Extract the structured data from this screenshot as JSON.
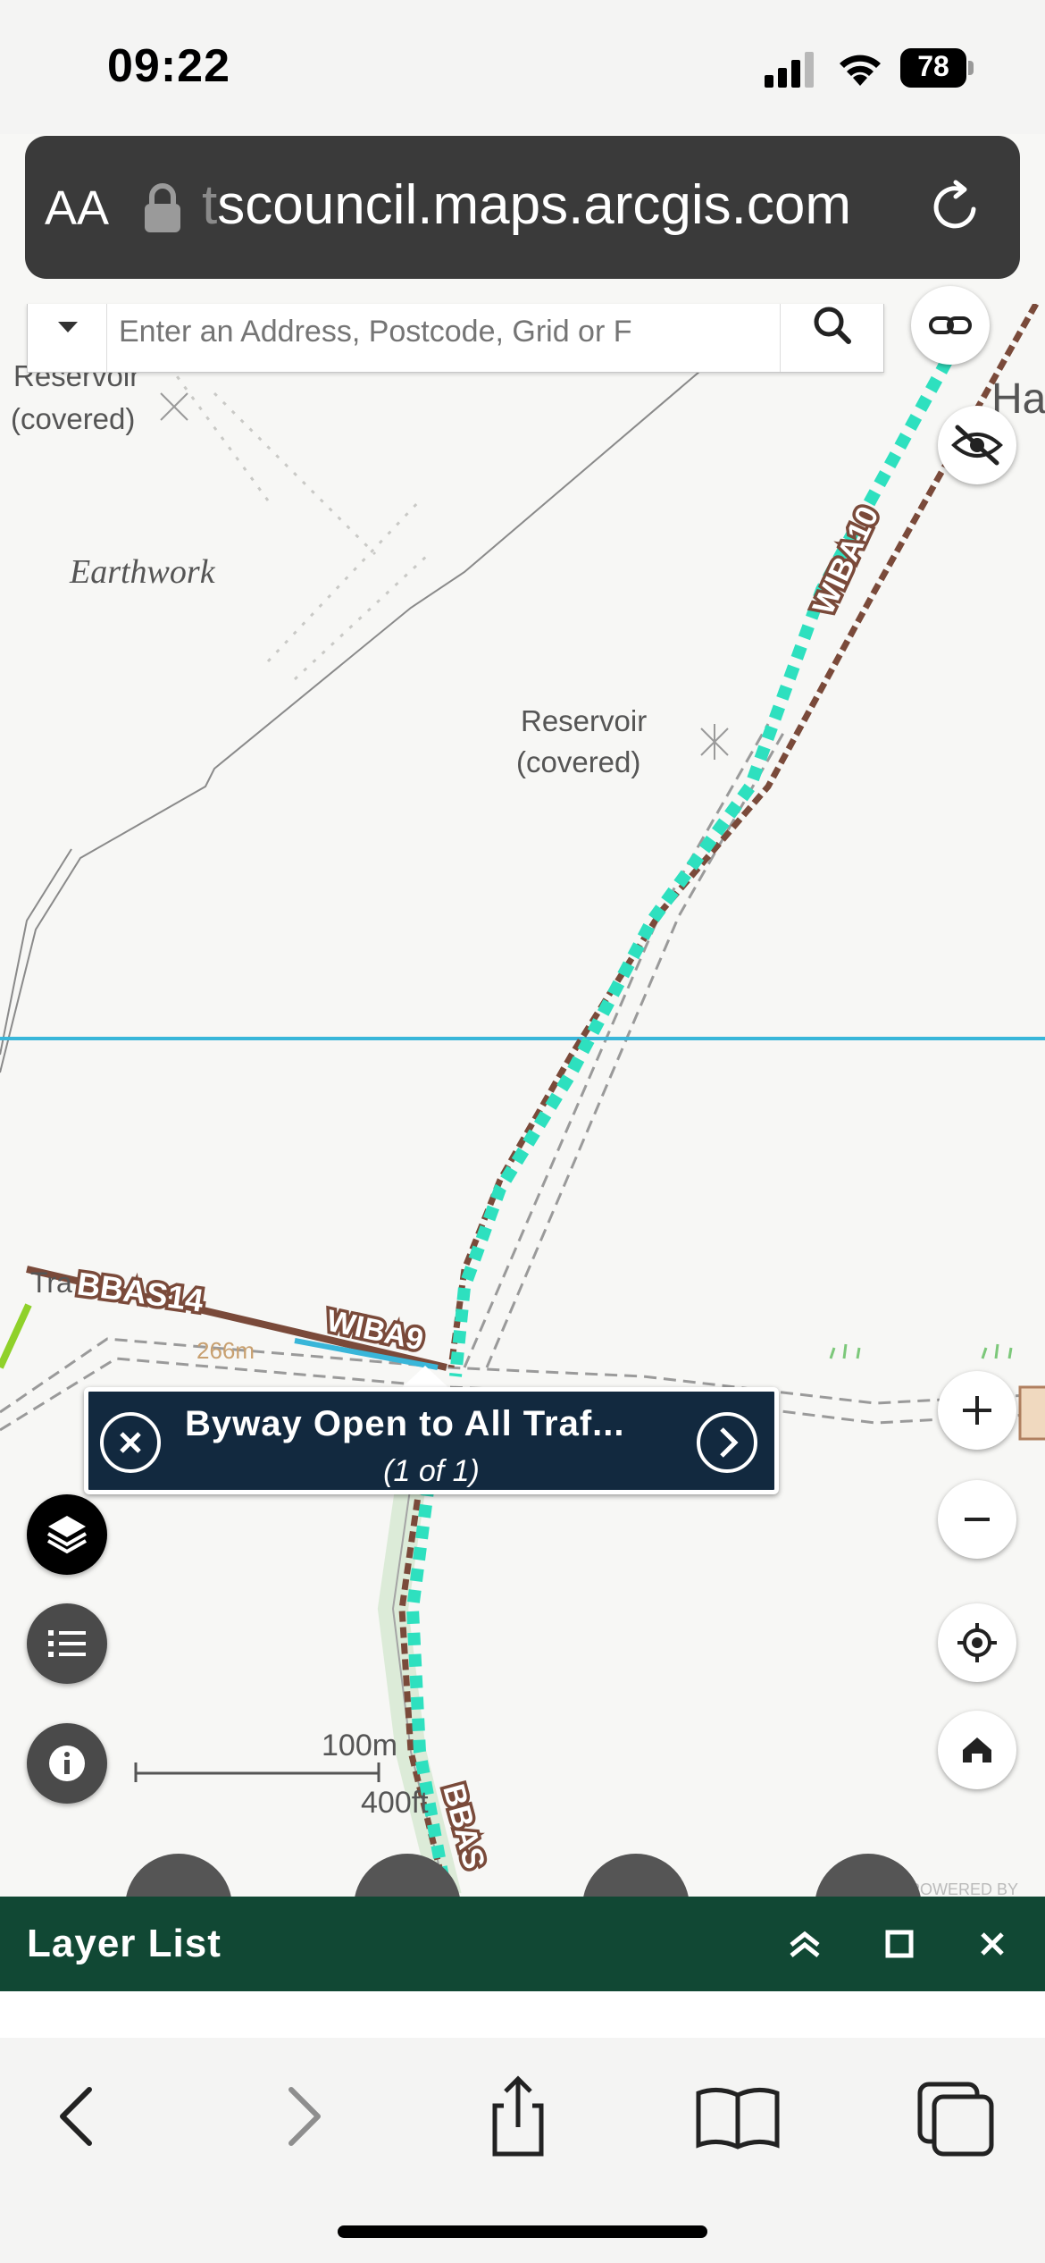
{
  "status_bar": {
    "time": "09:22",
    "battery": "78"
  },
  "browser": {
    "text_size_button": "AA",
    "url_faded_prefix": "t",
    "url": "scouncil.maps.arcgis.com"
  },
  "search": {
    "placeholder": "Enter an Address, Postcode, Grid or F"
  },
  "map": {
    "labels": {
      "reservoir_1": [
        "Reservoir",
        "(covered)"
      ],
      "earthwork": "Earthwork",
      "reservoir_2": [
        "Reservoir",
        "(covered)"
      ],
      "route_wiba10": "WIBA10",
      "route_bbas14": "BBAS14",
      "route_wiba9": "WIBA9",
      "route_bbas_bottom": "BBAS",
      "tra_fragment": "Tra",
      "ha_fragment": "Ha",
      "faded_label": "266m",
      "powered_by": "POWERED BY"
    },
    "colors": {
      "byway_dashed": "#2ee0bf",
      "byway_brown": "#7a4a3a",
      "boundary_line": "#39b6d9",
      "green_line": "#8fd12a"
    }
  },
  "popup": {
    "title": "Byway Open to All Traf...",
    "count": "(1 of 1)"
  },
  "scale": {
    "metric": "100m",
    "imperial": "400ft"
  },
  "panel": {
    "title": "Layer List"
  },
  "icons": {
    "search": "search-icon",
    "link": "link-icon",
    "visibility": "eye-slash-icon",
    "zoom_in": "plus-icon",
    "zoom_out": "minus-icon",
    "locate": "locate-icon",
    "home": "home-icon",
    "layers": "layers-icon",
    "legend": "list-icon",
    "info": "info-icon"
  }
}
